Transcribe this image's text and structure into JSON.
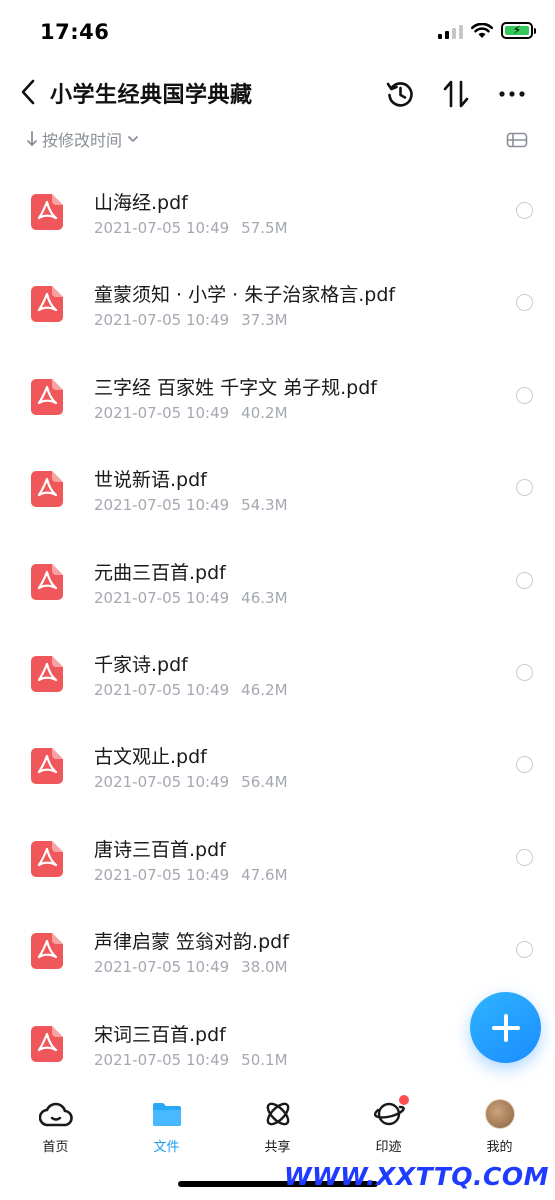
{
  "status_bar": {
    "time": "17:46"
  },
  "header": {
    "title": "小学生经典国学典藏",
    "icons": [
      "back-chevron-icon",
      "history-icon",
      "sort-arrows-icon",
      "more-icon"
    ]
  },
  "sort_bar": {
    "label": "按修改时间"
  },
  "files": [
    {
      "name": "山海经.pdf",
      "date": "2021-07-05 10:49",
      "size": "57.5M"
    },
    {
      "name": "童蒙须知 · 小学 · 朱子治家格言.pdf",
      "date": "2021-07-05 10:49",
      "size": "37.3M"
    },
    {
      "name": "三字经 百家姓 千字文 弟子规.pdf",
      "date": "2021-07-05 10:49",
      "size": "40.2M"
    },
    {
      "name": "世说新语.pdf",
      "date": "2021-07-05 10:49",
      "size": "54.3M"
    },
    {
      "name": "元曲三百首.pdf",
      "date": "2021-07-05 10:49",
      "size": "46.3M"
    },
    {
      "name": "千家诗.pdf",
      "date": "2021-07-05 10:49",
      "size": "46.2M"
    },
    {
      "name": "古文观止.pdf",
      "date": "2021-07-05 10:49",
      "size": "56.4M"
    },
    {
      "name": "唐诗三百首.pdf",
      "date": "2021-07-05 10:49",
      "size": "47.6M"
    },
    {
      "name": "声律启蒙 笠翁对韵.pdf",
      "date": "2021-07-05 10:49",
      "size": "38.0M"
    },
    {
      "name": "宋词三百首.pdf",
      "date": "2021-07-05 10:49",
      "size": "50.1M"
    }
  ],
  "tabs": [
    {
      "label": "首页",
      "icon": "cloud-icon",
      "active": false
    },
    {
      "label": "文件",
      "icon": "folder-icon",
      "active": true
    },
    {
      "label": "共享",
      "icon": "atom-icon",
      "active": false
    },
    {
      "label": "印迹",
      "icon": "planet-icon",
      "active": false,
      "badge": true
    },
    {
      "label": "我的",
      "icon": "avatar",
      "active": false
    }
  ],
  "colors": {
    "accent": "#1a9bf5",
    "pdf_red": "#f0575a",
    "meta_gray": "#a4a8b0"
  },
  "watermark": "WWW.XXTTQ.COM"
}
